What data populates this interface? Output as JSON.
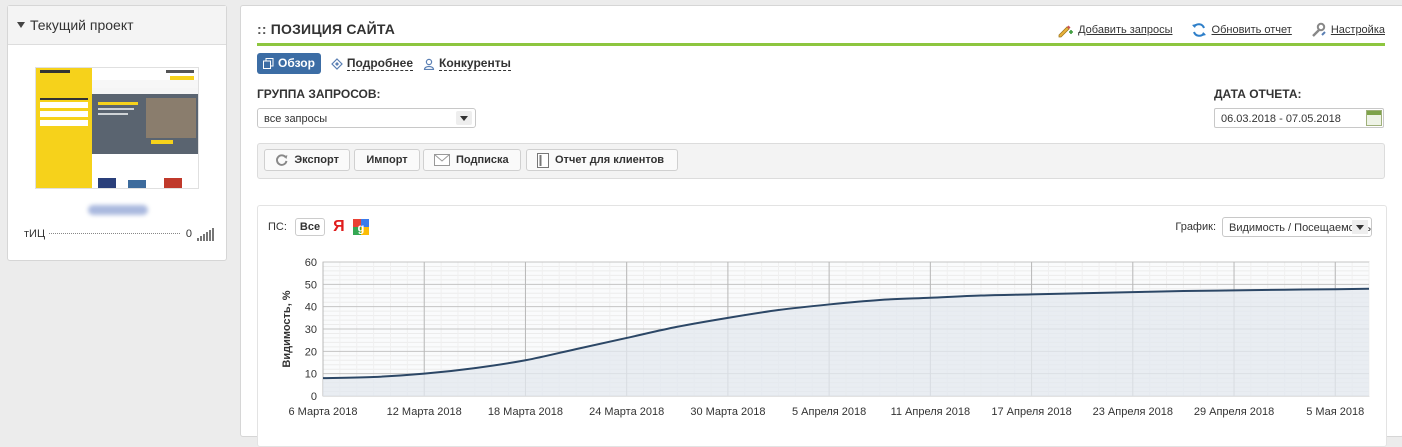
{
  "sidebar": {
    "title": "Текущий проект",
    "tic_label": "тИЦ",
    "tic_value": "0"
  },
  "main": {
    "title_prefix": "::",
    "title": "ПОЗИЦИЯ САЙТА",
    "links": {
      "add_queries": "Добавить запросы",
      "refresh_report": "Обновить отчет",
      "settings": "Настройка"
    },
    "tabs": [
      "Обзор",
      "Подробнее",
      "Конкуренты"
    ],
    "query_group_label": "ГРУППА ЗАПРОСОВ:",
    "query_group_value": "все запросы",
    "report_date_label": "ДАТА ОТЧЕТА:",
    "report_date_value": "06.03.2018 - 07.05.2018",
    "toolbar": {
      "export": "Экспорт",
      "import": "Импорт",
      "subscribe": "Подписка",
      "client_report": "Отчет для клиентов"
    },
    "ps_label": "ПС:",
    "ps_all": "Все",
    "ps_yandex": "Я",
    "graph_label": "График:",
    "graph_value": "Видимость / Посещаемость"
  },
  "colors": {
    "accent_green": "#8dc63f",
    "tab_active": "#3c6da5",
    "line": "#2c4766",
    "area": "#e3e8ef"
  },
  "chart_data": {
    "type": "area",
    "ylabel": "Видимость, %",
    "ylim": [
      0,
      60
    ],
    "yticks": [
      0,
      10,
      20,
      30,
      40,
      50,
      60
    ],
    "xticks": [
      "6 Марта 2018",
      "12 Марта 2018",
      "18 Марта 2018",
      "24 Марта 2018",
      "30 Марта 2018",
      "5 Апреля 2018",
      "11 Апреля 2018",
      "17 Апреля 2018",
      "23 Апреля 2018",
      "29 Апреля 2018",
      "5 Мая 2018"
    ],
    "grid": true,
    "series": [
      {
        "x": [
          "2018-03-06",
          "2018-03-09",
          "2018-03-12",
          "2018-03-15",
          "2018-03-18",
          "2018-03-21",
          "2018-03-24",
          "2018-03-27",
          "2018-03-30",
          "2018-04-02",
          "2018-04-05",
          "2018-04-08",
          "2018-04-11",
          "2018-04-14",
          "2018-04-17",
          "2018-04-20",
          "2018-04-23",
          "2018-04-26",
          "2018-04-29",
          "2018-05-02",
          "2018-05-05",
          "2018-05-07"
        ],
        "values": [
          8,
          8.5,
          10,
          12.5,
          16,
          21,
          26,
          31,
          35,
          38.5,
          41,
          43,
          44,
          45,
          45.5,
          46,
          46.5,
          47,
          47.3,
          47.6,
          47.8,
          48
        ]
      }
    ]
  }
}
